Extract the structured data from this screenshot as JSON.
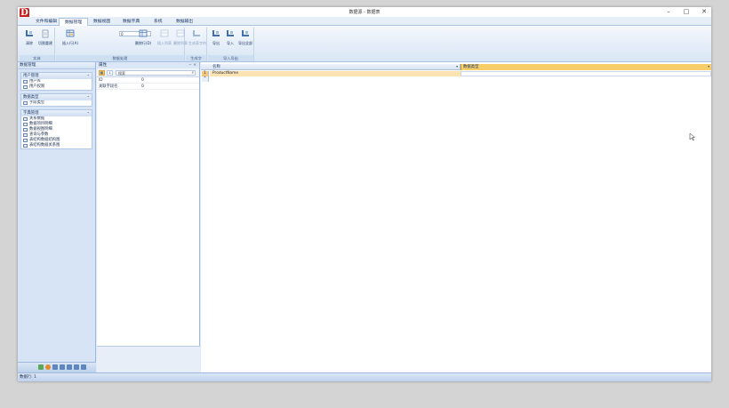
{
  "window": {
    "logo_letter": "D",
    "title": "数据源 - 数据表",
    "controls": [
      "–",
      "□",
      "✕"
    ]
  },
  "tabs": [
    {
      "label": "文件和编辑",
      "active": false
    },
    {
      "label": "数据管理",
      "active": true
    },
    {
      "label": "数据视图",
      "active": false
    },
    {
      "label": "数据字典",
      "active": false
    },
    {
      "label": "系统",
      "active": false
    },
    {
      "label": "数据输出",
      "active": false
    }
  ],
  "ribbon": {
    "groups": [
      {
        "label": "实体",
        "buttons": [
          "清除",
          "切割重建"
        ]
      },
      {
        "label": "数据处理",
        "buttons": [
          "插入行(A)",
          "删除行(D)",
          "插入列表",
          "删除列表"
        ]
      },
      {
        "label": "生成字",
        "buttons": [
          "生成表字符"
        ]
      },
      {
        "label": "导入导出",
        "buttons": [
          "导出",
          "导入",
          "导出全部"
        ]
      }
    ],
    "input_value": "0"
  },
  "leftpane": {
    "title": "数据管理",
    "groups": [
      {
        "head": "用户管理",
        "items": [
          "用户库",
          "用户权限"
        ]
      },
      {
        "head": "数据类型",
        "items": [
          "字段类型"
        ]
      },
      {
        "head": "字典管理",
        "items": [
          "关系数据",
          "数据项目明细",
          "数据视图明细",
          "查询与参数",
          "表结构数据结构图",
          "表结构数据关系图"
        ]
      }
    ]
  },
  "properties": {
    "title": "属性",
    "pin": "− ×",
    "search_placeholder": "搜索",
    "rows": [
      {
        "name": "ID",
        "value": "0"
      },
      {
        "name": "关联字段名",
        "value": "0"
      }
    ]
  },
  "grid": {
    "columns": [
      "名称",
      "数据类型"
    ],
    "rows": [
      {
        "num": "1",
        "c1": "ProductName",
        "c2": ""
      },
      {
        "num": "*",
        "c1": "",
        "c2": ""
      }
    ]
  },
  "statusbar": {
    "text": "数据行: 1"
  }
}
